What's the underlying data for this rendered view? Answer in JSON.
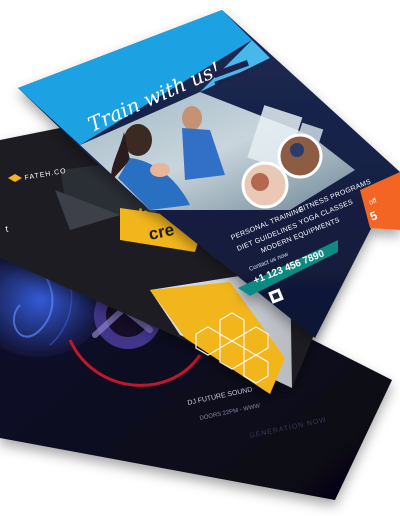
{
  "back_flyer": {
    "subtitle": "DJ FUTURE SOUND",
    "doors": "DOORS 22PM - WWW",
    "footer": "GENERATION NOW",
    "colors": {
      "bg": "#0d0c1e",
      "accent": "#6a3ccf",
      "glow": "#c2182b"
    }
  },
  "middle_flyer": {
    "brand": "FATEH.CO",
    "headline_top": "th",
    "headline_bottom": "cre",
    "edge_text": "t",
    "colors": {
      "dark": "#1c1d22",
      "gold": "#f2b51c",
      "grey": "#4a4d55"
    }
  },
  "gym_flyer": {
    "tagline": "Train with us!",
    "services": [
      "PERSONAL TRAINING",
      "FITNESS PROGRAMS",
      "DIET GUIDELINES",
      "YOGA CLASSES",
      "MODERN EQUIPMENTS"
    ],
    "contact_label": "Contact us now",
    "phone": "+1 123 456 7890",
    "offer_label": "off",
    "offer_value": "5",
    "colors": {
      "blue": "#1ba1e2",
      "navy": "#1a2349",
      "orange": "#f26522",
      "teal": "#0c8b83"
    }
  }
}
